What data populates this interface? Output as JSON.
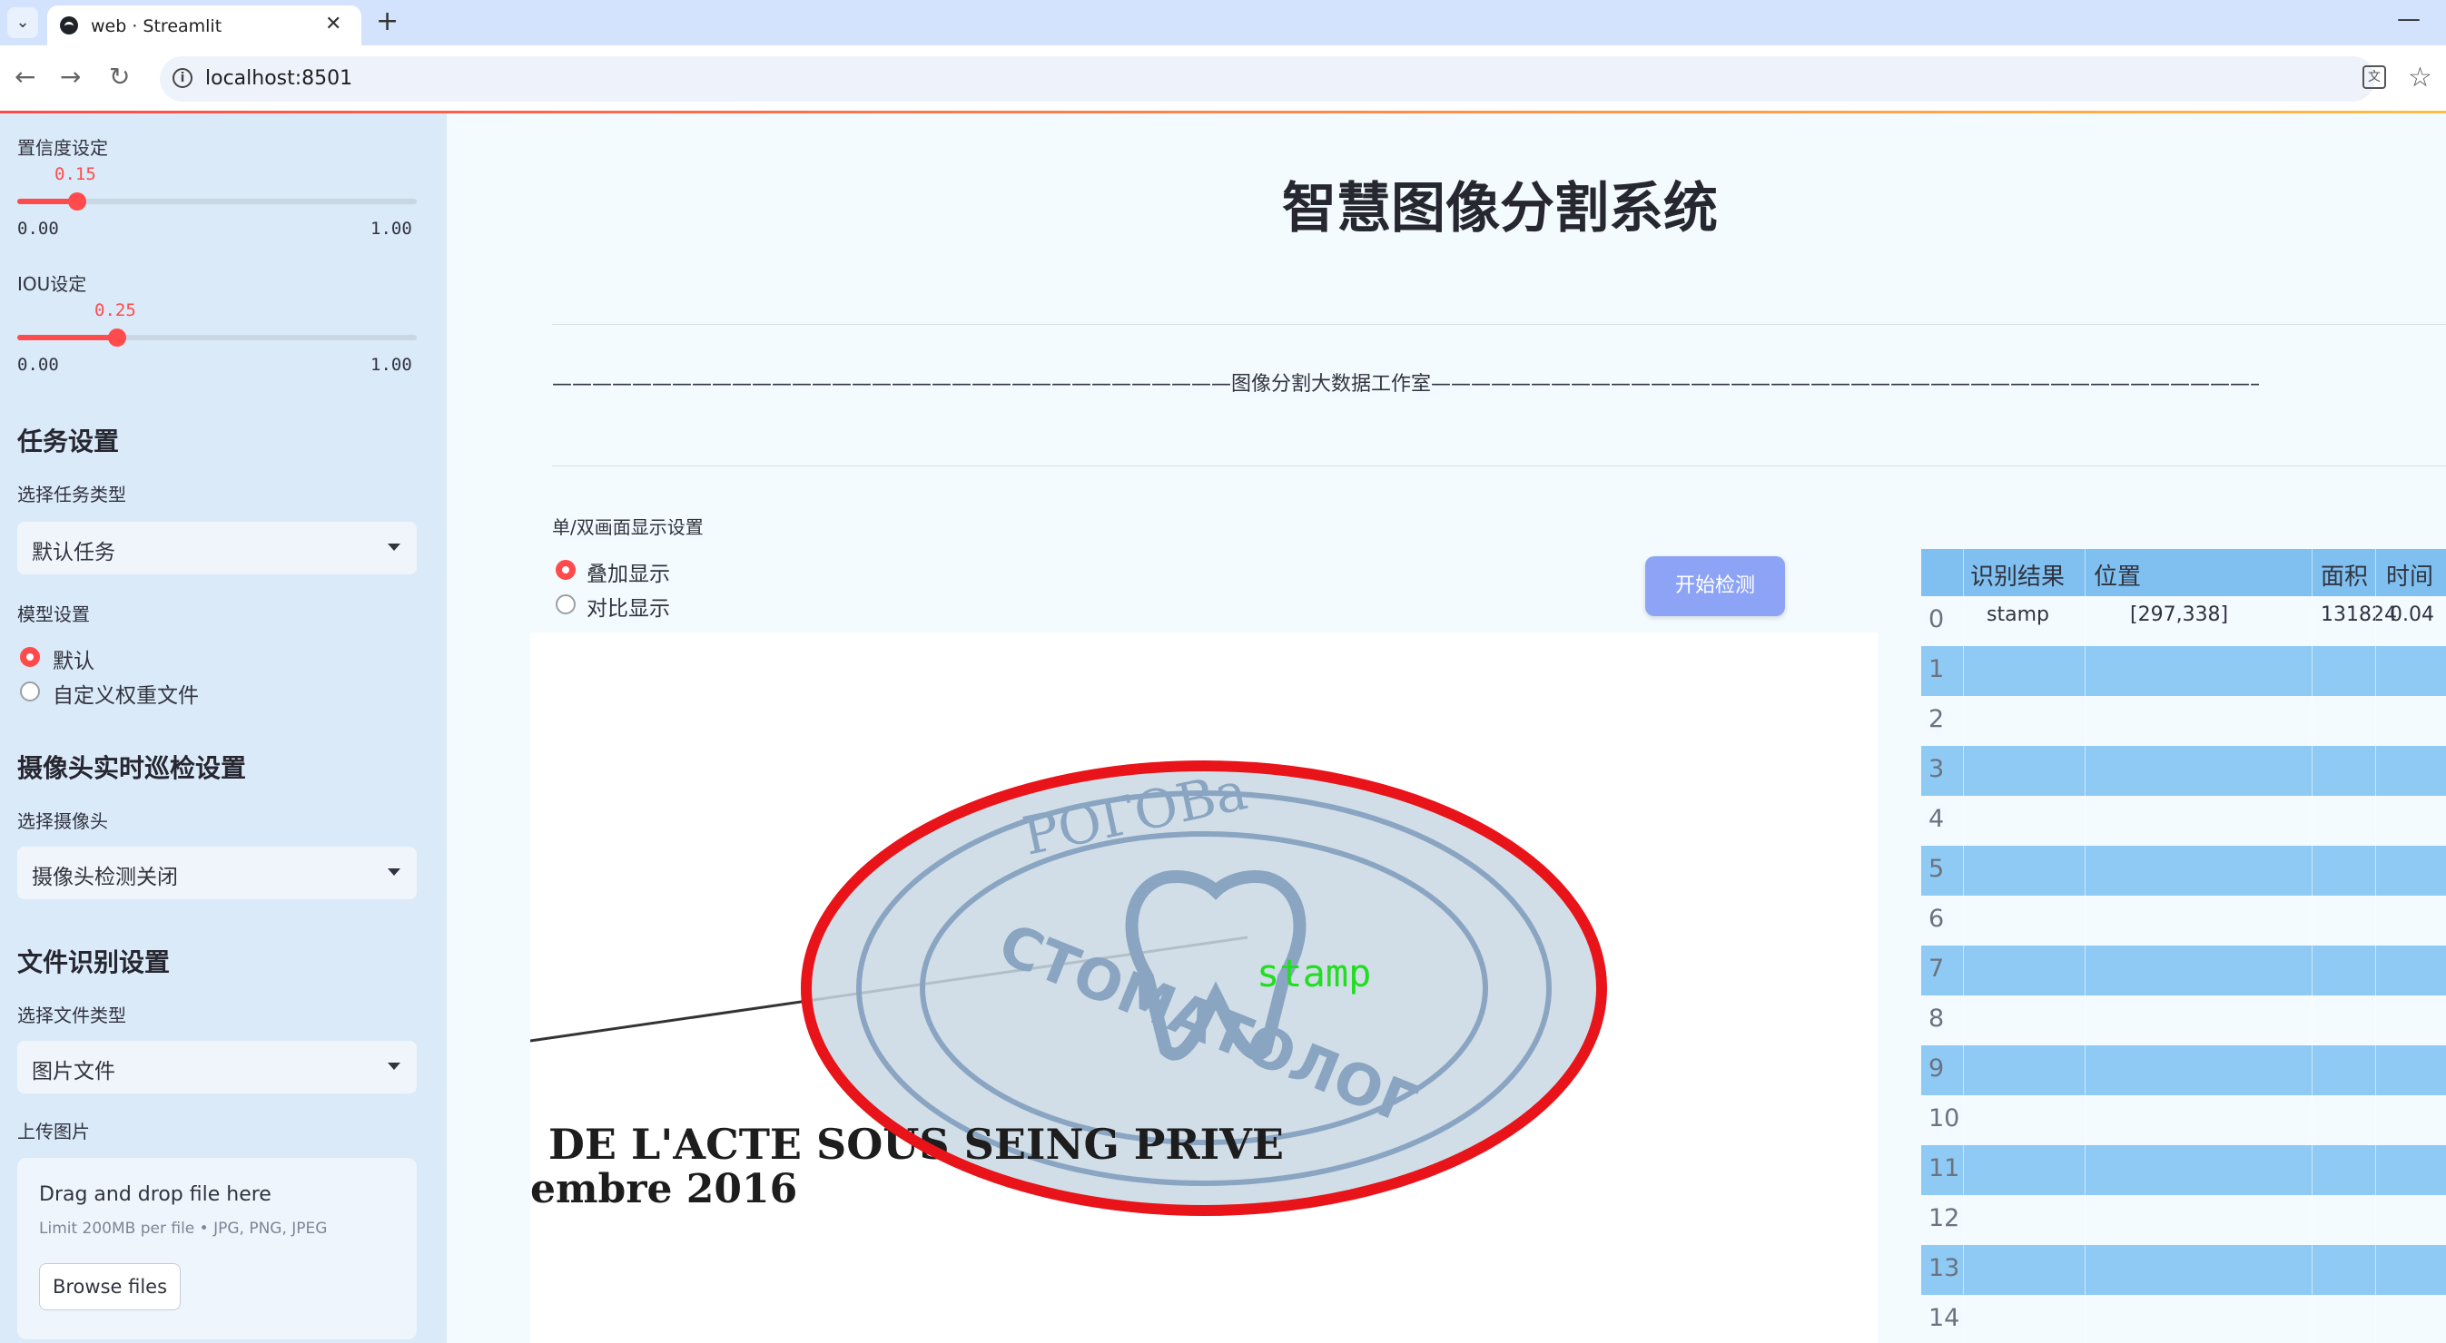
{
  "browser": {
    "tab_title": "web · Streamlit",
    "url": "localhost:8501"
  },
  "sidebar": {
    "confidence": {
      "label": "置信度设定",
      "value": "0.15",
      "fraction": 0.15,
      "min": "0.00",
      "max": "1.00"
    },
    "iou": {
      "label": "IOU设定",
      "value": "0.25",
      "fraction": 0.25,
      "min": "0.00",
      "max": "1.00"
    },
    "task_header": "任务设置",
    "task_type_label": "选择任务类型",
    "task_type_value": "默认任务",
    "model_label": "模型设置",
    "model_options": [
      "默认",
      "自定义权重文件"
    ],
    "model_selected": "默认",
    "camera_header": "摄像头实时巡检设置",
    "camera_label": "选择摄像头",
    "camera_value": "摄像头检测关闭",
    "file_header": "文件识别设置",
    "file_type_label": "选择文件类型",
    "file_type_value": "图片文件",
    "upload_label": "上传图片",
    "upload_title": "Drag and drop file here",
    "upload_limit": "Limit 200MB per file • JPG, PNG, JPEG",
    "browse_label": "Browse files"
  },
  "main": {
    "title": "智慧图像分割系统",
    "banner": "——————————————————————————————————图像分割大数据工作室——————————————————————————————————————————",
    "display_mode_label": "单/双画面显示设置",
    "display_options": [
      "叠加显示",
      "对比显示"
    ],
    "display_selected": "叠加显示",
    "start_button": "开始检测",
    "detection_label": "stamp",
    "document_text_line1": "DE L'ACTE SOUS SEING PRIVE",
    "document_text_line2": "embre 2016",
    "stamp_text_top": "POГOBa",
    "stamp_text_mid": "СТОМАТОЛОГ",
    "colors": {
      "accent": "#ff4b4b",
      "button": "#8da4f6",
      "mask_outline": "#e8141a",
      "label_green": "#22dd22"
    }
  },
  "table": {
    "columns": [
      "识别结果",
      "位置",
      "面积",
      "时间"
    ],
    "rows": [
      {
        "idx": "0",
        "result": "stamp",
        "position": "[297,338]",
        "area": "131824",
        "time": "0.04"
      },
      {
        "idx": "1"
      },
      {
        "idx": "2"
      },
      {
        "idx": "3"
      },
      {
        "idx": "4"
      },
      {
        "idx": "5"
      },
      {
        "idx": "6"
      },
      {
        "idx": "7"
      },
      {
        "idx": "8"
      },
      {
        "idx": "9"
      },
      {
        "idx": "10"
      },
      {
        "idx": "11"
      },
      {
        "idx": "12"
      },
      {
        "idx": "13"
      },
      {
        "idx": "14"
      }
    ]
  }
}
